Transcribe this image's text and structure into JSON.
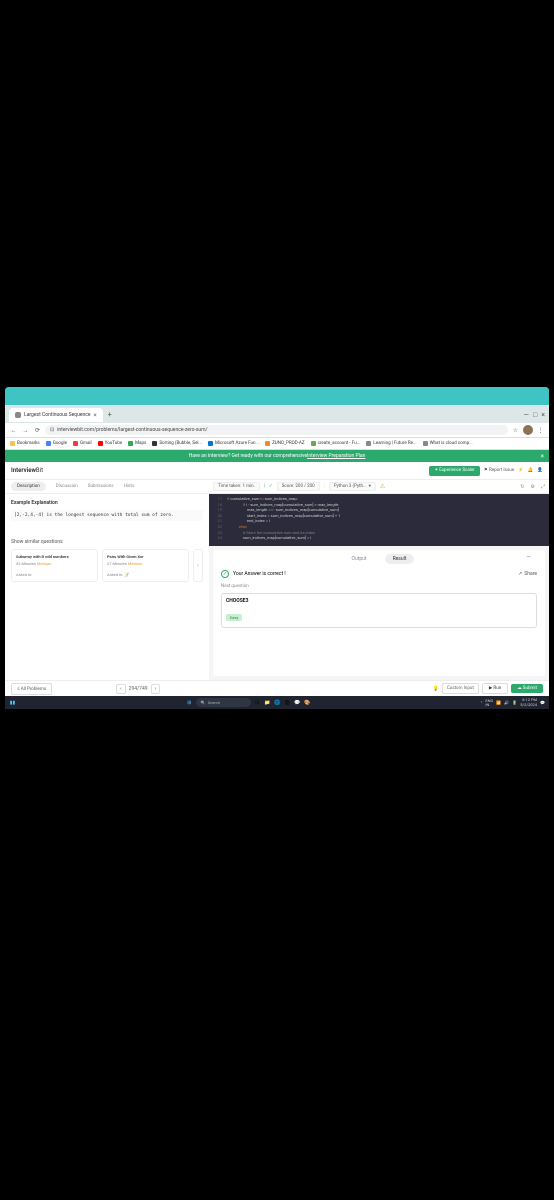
{
  "browser": {
    "tab_title": "Largest Continuous Sequence",
    "url": "interviewbit.com/problems/largest-continuous-sequence-zero-sum/",
    "nav_back": "←",
    "nav_fwd": "→",
    "nav_reload": "⟳",
    "secure_icon": "⊡",
    "star_icon": "☆",
    "menu_icon": "⋮",
    "win_min": "—",
    "win_max": "□",
    "win_close": "×"
  },
  "bookmarks": {
    "b1": "Bookmarks",
    "b2": "Google",
    "b3": "Gmail",
    "b4": "YouTube",
    "b5": "Maps",
    "b6": "Sorting (Bubble, Sel...",
    "b7": "Microsoft Azure Fun...",
    "b8": "ZUNO_PROD-AZ",
    "b9": "create_account - Fu...",
    "b10": "Learning | Future Re...",
    "b11": "What is cloud comp..."
  },
  "banner": {
    "text": "Have an interview? Get ready with our comprehensive ",
    "link": "Interview Preparation Plan",
    "close": "×"
  },
  "header": {
    "logo_a": "Interview",
    "logo_b": "Bit",
    "exp_btn": "✦ Experience Scaler",
    "report": "⚑ Report Issue",
    "bolt": "⚡"
  },
  "problem_tabs": {
    "desc": "Description",
    "disc": "Discussion",
    "subm": "Submissions",
    "hints": "Hints"
  },
  "problem": {
    "section": "Example Explanation",
    "example": "[2,-2,4,-4] is the longest sequence with total sum of zero.",
    "similar_heading": "Show similar questions"
  },
  "similar": {
    "c1_title": "Subarray with B odd numbers",
    "c1_meta_a": "52 Minutes",
    "c1_meta_b": "Medium",
    "c1_asked": "Asked in:",
    "c2_title": "Pairs With Given Xor",
    "c2_meta_a": "27 Minutes",
    "c2_meta_b": "Medium",
    "c2_asked": "Asked in:",
    "arrow": "›"
  },
  "editor_header": {
    "time": "Time taken: 1 min.",
    "score": "Score: 200 / 200",
    "lang": "Python 3 (Pyth...",
    "warn": "⚠",
    "icon_reset": "↻",
    "icon_settings": "⚙",
    "icon_expand": "⤢"
  },
  "code": {
    "lines": [
      {
        "n": "17",
        "t": "            if cumulative_sum in sum_indices_map:"
      },
      {
        "n": "18",
        "t": "                if i - sum_indices_map[cumulative_sum] > max_length:"
      },
      {
        "n": "19",
        "t": "                    max_length = i - sum_indices_map[cumulative_sum]"
      },
      {
        "n": "20",
        "t": "                    start_index = sum_indices_map[cumulative_sum] + 1"
      },
      {
        "n": "21",
        "t": "                    end_index = i"
      },
      {
        "n": "22",
        "t": "            else:"
      },
      {
        "n": "23",
        "t": "                # Store the cumulative sum and its index"
      },
      {
        "n": "24",
        "t": "                sum_indices_map[cumulative_sum] = i"
      }
    ]
  },
  "output": {
    "tab_output": "Output",
    "tab_result": "Result",
    "minimize": "—",
    "check": "✓",
    "msg": "Your Answer is correct !",
    "share_icon": "↗",
    "share": "Share",
    "next_label": "Next question",
    "next_title": "CHOOSE3",
    "next_diff": "Easy"
  },
  "bottom": {
    "all": "≡ All Problems",
    "prev": "‹",
    "counter": "294/749",
    "next": "›",
    "light_icon": "💡",
    "custom": "Custom Input",
    "run": "▶ Run",
    "submit": "☁ Submit"
  },
  "taskbar": {
    "search": "Search",
    "lang": "ENG\nIN",
    "time": "8:12 PM",
    "date": "5/2/2024"
  }
}
